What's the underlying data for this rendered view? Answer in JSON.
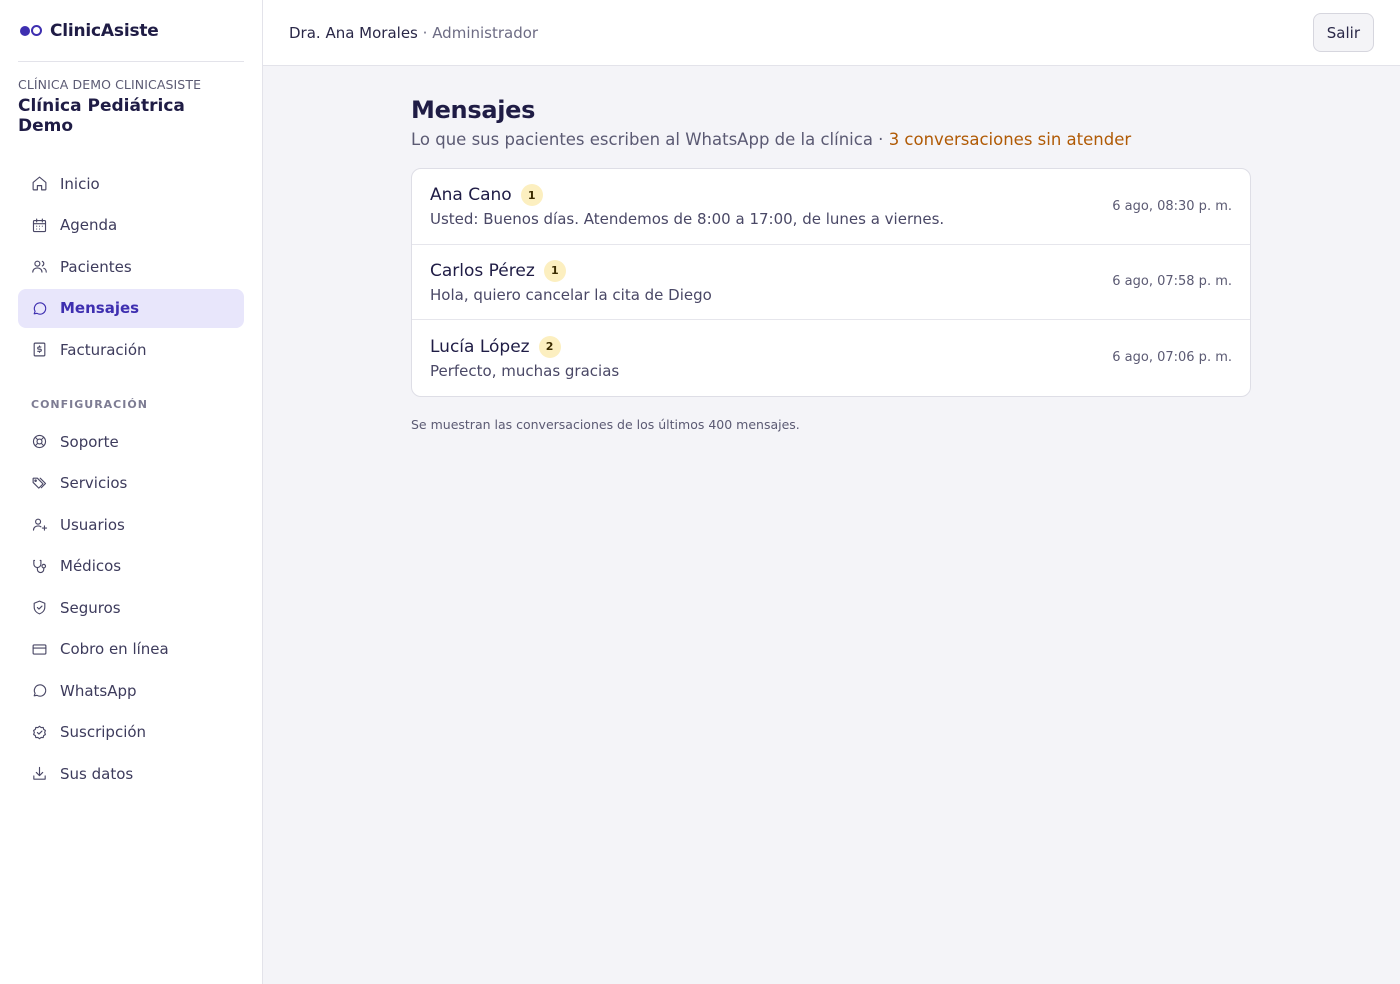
{
  "brand": {
    "name": "ClinicAsiste",
    "accent": "#3e2fb0"
  },
  "clinic": {
    "caption": "CLÍNICA DEMO CLINICASISTE",
    "name": "Clínica Pediátrica Demo"
  },
  "nav": {
    "main": [
      {
        "label": "Inicio",
        "icon": "home-icon"
      },
      {
        "label": "Agenda",
        "icon": "calendar-icon"
      },
      {
        "label": "Pacientes",
        "icon": "users-icon"
      },
      {
        "label": "Mensajes",
        "icon": "message-icon",
        "active": true
      },
      {
        "label": "Facturación",
        "icon": "invoice-icon"
      }
    ],
    "section_label": "CONFIGURACIÓN",
    "config": [
      {
        "label": "Soporte",
        "icon": "lifebuoy-icon"
      },
      {
        "label": "Servicios",
        "icon": "tags-icon"
      },
      {
        "label": "Usuarios",
        "icon": "user-plus-icon"
      },
      {
        "label": "Médicos",
        "icon": "stethoscope-icon"
      },
      {
        "label": "Seguros",
        "icon": "shield-icon"
      },
      {
        "label": "Cobro en línea",
        "icon": "credit-card-icon"
      },
      {
        "label": "WhatsApp",
        "icon": "message-icon"
      },
      {
        "label": "Suscripción",
        "icon": "badge-check-icon"
      },
      {
        "label": "Sus datos",
        "icon": "download-icon"
      }
    ]
  },
  "topbar": {
    "user_name": "Dra. Ana Morales",
    "separator": " · ",
    "user_role": "Administrador",
    "logout_label": "Salir"
  },
  "page": {
    "title": "Mensajes",
    "subtitle": "Lo que sus pacientes escriben al WhatsApp de la clínica",
    "subtitle_sep": " · ",
    "pending_text": "3 conversaciones sin atender",
    "pending_color": "#b05a05",
    "footnote": "Se muestran las conversaciones de los últimos 400 mensajes."
  },
  "conversations": [
    {
      "name": "Ana Cano",
      "unread": "1",
      "preview": "Usted: Buenos días. Atendemos de 8:00 a 17:00, de lunes a viernes.",
      "time": "6 ago, 08:30 p. m."
    },
    {
      "name": "Carlos Pérez",
      "unread": "1",
      "preview": "Hola, quiero cancelar la cita de Diego",
      "time": "6 ago, 07:58 p. m."
    },
    {
      "name": "Lucía López",
      "unread": "2",
      "preview": "Perfecto, muchas gracias",
      "time": "6 ago, 07:06 p. m."
    }
  ]
}
